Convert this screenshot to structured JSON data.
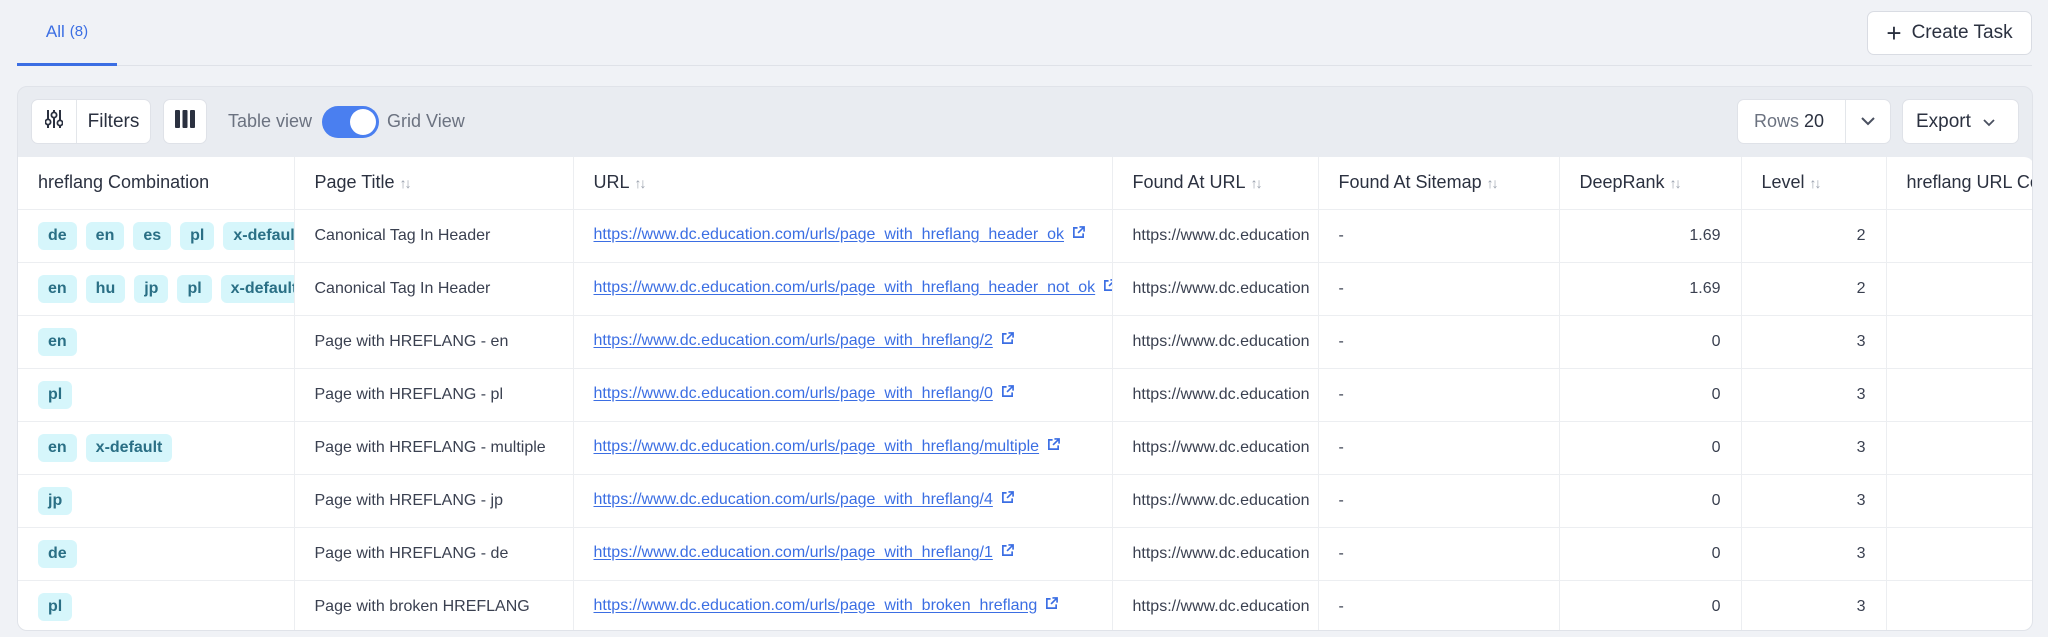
{
  "tabs": [
    {
      "label": "All",
      "count": "(8)"
    }
  ],
  "header": {
    "create_task_label": "Create Task"
  },
  "toolbar": {
    "filters_label": "Filters",
    "toggle_left_label": "Table view",
    "toggle_right_label": "Grid View",
    "toggle_on": true,
    "rows_label": "Rows",
    "rows_value": "20",
    "export_label": "Export"
  },
  "colors": {
    "accent": "#3b6ee3",
    "tag_bg": "#d6f6fb",
    "tag_text": "#2a6f85"
  },
  "table": {
    "columns": [
      {
        "label": "hreflang Combination",
        "sortable": false
      },
      {
        "label": "Page Title",
        "sortable": true
      },
      {
        "label": "URL",
        "sortable": true
      },
      {
        "label": "Found At URL",
        "sortable": true
      },
      {
        "label": "Found At Sitemap",
        "sortable": true
      },
      {
        "label": "DeepRank",
        "sortable": true
      },
      {
        "label": "Level",
        "sortable": true
      },
      {
        "label": "hreflang URL Co",
        "sortable": false
      }
    ],
    "rows": [
      {
        "tags": [
          "de",
          "en",
          "es",
          "pl",
          "x-default"
        ],
        "title": "Canonical Tag In Header",
        "url": "https://www.dc.education.com/urls/page_with_hreflang_header_ok",
        "found_at_url": "https://www.dc.education",
        "found_at_sitemap": "-",
        "deeprank": "1.69",
        "level": "2",
        "hreflang_url_count": ""
      },
      {
        "tags": [
          "en",
          "hu",
          "jp",
          "pl",
          "x-default"
        ],
        "title": "Canonical Tag In Header",
        "url": "https://www.dc.education.com/urls/page_with_hreflang_header_not_ok",
        "found_at_url": "https://www.dc.education",
        "found_at_sitemap": "-",
        "deeprank": "1.69",
        "level": "2",
        "hreflang_url_count": ""
      },
      {
        "tags": [
          "en"
        ],
        "title": "Page with HREFLANG - en",
        "url": "https://www.dc.education.com/urls/page_with_hreflang/2",
        "found_at_url": "https://www.dc.education",
        "found_at_sitemap": "-",
        "deeprank": "0",
        "level": "3",
        "hreflang_url_count": ""
      },
      {
        "tags": [
          "pl"
        ],
        "title": "Page with HREFLANG - pl",
        "url": "https://www.dc.education.com/urls/page_with_hreflang/0",
        "found_at_url": "https://www.dc.education",
        "found_at_sitemap": "-",
        "deeprank": "0",
        "level": "3",
        "hreflang_url_count": ""
      },
      {
        "tags": [
          "en",
          "x-default"
        ],
        "title": "Page with HREFLANG - multiple",
        "url": "https://www.dc.education.com/urls/page_with_hreflang/multiple",
        "found_at_url": "https://www.dc.education",
        "found_at_sitemap": "-",
        "deeprank": "0",
        "level": "3",
        "hreflang_url_count": ""
      },
      {
        "tags": [
          "jp"
        ],
        "title": "Page with HREFLANG - jp",
        "url": "https://www.dc.education.com/urls/page_with_hreflang/4",
        "found_at_url": "https://www.dc.education",
        "found_at_sitemap": "-",
        "deeprank": "0",
        "level": "3",
        "hreflang_url_count": ""
      },
      {
        "tags": [
          "de"
        ],
        "title": "Page with HREFLANG - de",
        "url": "https://www.dc.education.com/urls/page_with_hreflang/1",
        "found_at_url": "https://www.dc.education",
        "found_at_sitemap": "-",
        "deeprank": "0",
        "level": "3",
        "hreflang_url_count": ""
      },
      {
        "tags": [
          "pl"
        ],
        "title": "Page with broken HREFLANG",
        "url": "https://www.dc.education.com/urls/page_with_broken_hreflang",
        "found_at_url": "https://www.dc.education",
        "found_at_sitemap": "-",
        "deeprank": "0",
        "level": "3",
        "hreflang_url_count": ""
      }
    ]
  }
}
